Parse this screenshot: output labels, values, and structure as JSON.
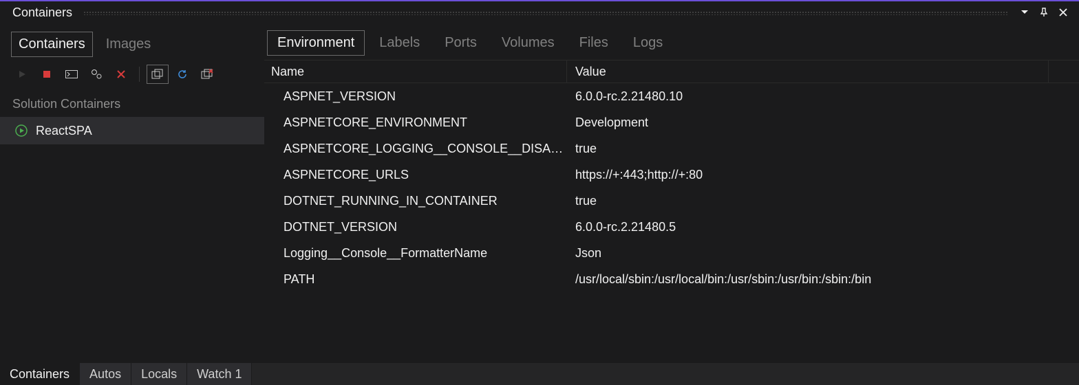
{
  "panel": {
    "title": "Containers"
  },
  "sidebar": {
    "tabs": [
      {
        "label": "Containers",
        "active": true
      },
      {
        "label": "Images",
        "active": false
      }
    ],
    "sectionLabel": "Solution Containers",
    "items": [
      {
        "name": "ReactSPA",
        "running": true,
        "selected": true
      }
    ]
  },
  "content": {
    "tabs": [
      {
        "label": "Environment",
        "active": true
      },
      {
        "label": "Labels",
        "active": false
      },
      {
        "label": "Ports",
        "active": false
      },
      {
        "label": "Volumes",
        "active": false
      },
      {
        "label": "Files",
        "active": false
      },
      {
        "label": "Logs",
        "active": false
      }
    ],
    "columns": {
      "name": "Name",
      "value": "Value"
    },
    "rows": [
      {
        "name": "ASPNET_VERSION",
        "value": "6.0.0-rc.2.21480.10"
      },
      {
        "name": "ASPNETCORE_ENVIRONMENT",
        "value": "Development"
      },
      {
        "name": "ASPNETCORE_LOGGING__CONSOLE__DISA…",
        "value": "true"
      },
      {
        "name": "ASPNETCORE_URLS",
        "value": "https://+:443;http://+:80"
      },
      {
        "name": "DOTNET_RUNNING_IN_CONTAINER",
        "value": "true"
      },
      {
        "name": "DOTNET_VERSION",
        "value": "6.0.0-rc.2.21480.5"
      },
      {
        "name": "Logging__Console__FormatterName",
        "value": "Json"
      },
      {
        "name": "PATH",
        "value": "/usr/local/sbin:/usr/local/bin:/usr/sbin:/usr/bin:/sbin:/bin"
      }
    ]
  },
  "bottomTabs": [
    {
      "label": "Containers",
      "active": true
    },
    {
      "label": "Autos",
      "active": false
    },
    {
      "label": "Locals",
      "active": false
    },
    {
      "label": "Watch 1",
      "active": false
    }
  ]
}
